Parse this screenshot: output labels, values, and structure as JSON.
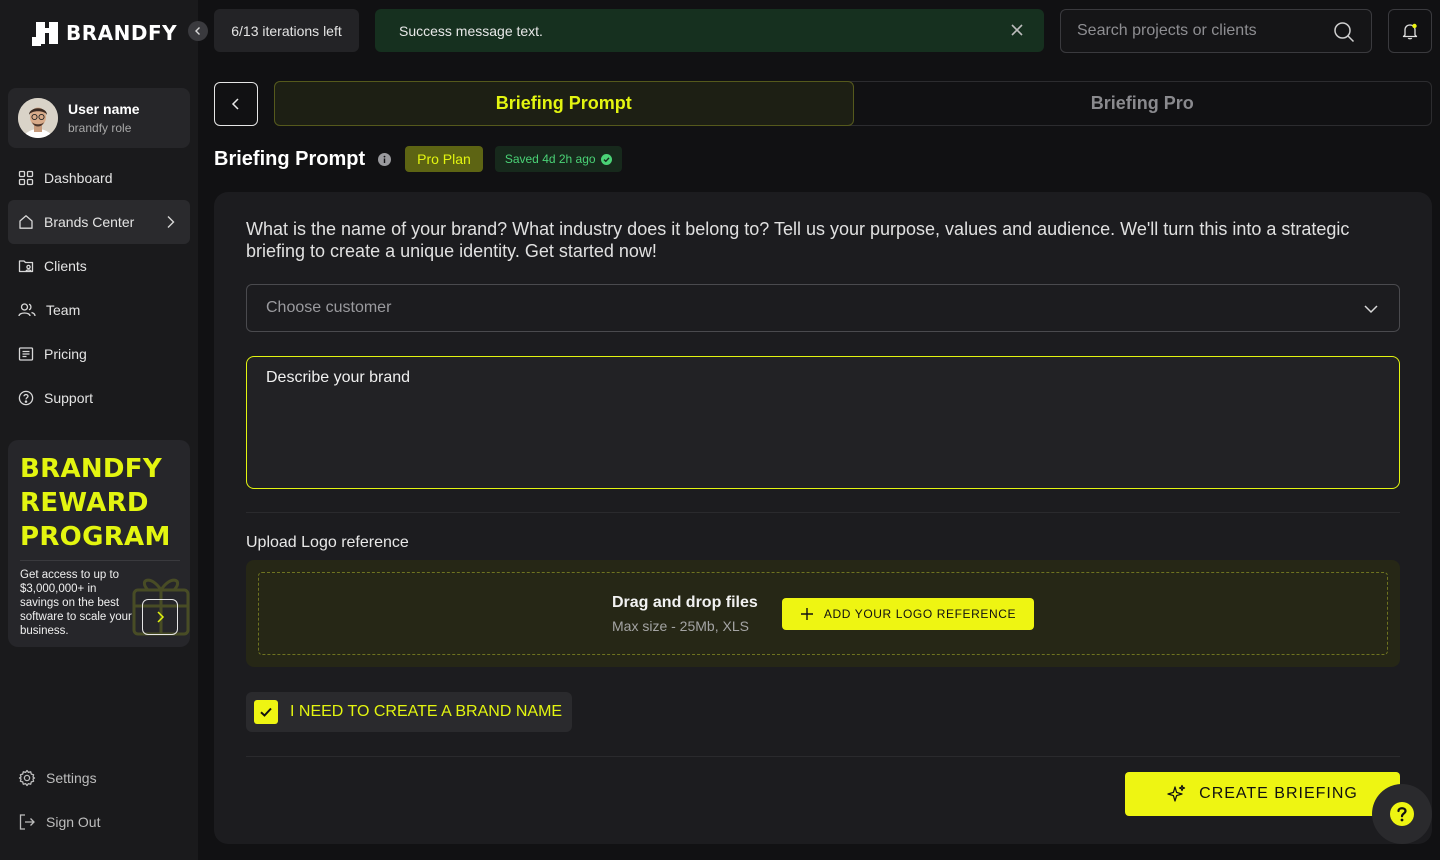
{
  "app": {
    "logo_text": "BRANDFY"
  },
  "user": {
    "name": "User name",
    "role": "brandfy role"
  },
  "nav": {
    "items": [
      {
        "label": "Dashboard",
        "icon": "grid-icon"
      },
      {
        "label": "Brands Center",
        "icon": "home-icon",
        "active": true
      },
      {
        "label": "Clients",
        "icon": "clients-folder-icon"
      },
      {
        "label": "Team",
        "icon": "team-icon"
      },
      {
        "label": "Pricing",
        "icon": "pricing-icon"
      },
      {
        "label": "Support",
        "icon": "support-icon"
      }
    ],
    "bottom": [
      {
        "label": "Settings",
        "icon": "gear-icon"
      },
      {
        "label": "Sign Out",
        "icon": "sign-out-icon"
      }
    ]
  },
  "reward": {
    "title_line1": "BRANDFY",
    "title_line2": "REWARD",
    "title_line3": "PROGRAM",
    "text": "Get access to up to $3,000,000+ in savings on the best software to scale your business."
  },
  "topbar": {
    "iterations": "6/13 iterations left",
    "toast": "Success message text.",
    "search_placeholder": "Search projects or clients"
  },
  "tabs": [
    {
      "label": "Briefing Prompt",
      "active": true
    },
    {
      "label": "Briefing Pro",
      "active": false
    }
  ],
  "page": {
    "title": "Briefing Prompt",
    "plan_badge": "Pro Plan",
    "saved_badge": "Saved 4d 2h ago"
  },
  "form": {
    "intro": "What is the name of your brand? What industry does it belong to? Tell us your purpose, values and audience. We'll turn this into a strategic briefing to create a unique identity. Get started now!",
    "customer_placeholder": "Choose customer",
    "describe_placeholder": "Describe your brand",
    "upload_label": "Upload Logo reference",
    "upload_title": "Drag and drop files",
    "upload_sub": "Max size - 25Mb, XLS",
    "upload_button": "ADD YOUR LOGO REFERENCE",
    "checkbox_label": "I NEED TO CREATE A BRAND NAME",
    "checkbox_checked": true,
    "submit_button": "CREATE BRIEFING"
  },
  "colors": {
    "accent": "#eef512",
    "background": "#111113",
    "sidebar": "#1a1a1c",
    "card": "#1c1c1f",
    "success": "#4ad276",
    "toast_bg": "#16301f"
  }
}
